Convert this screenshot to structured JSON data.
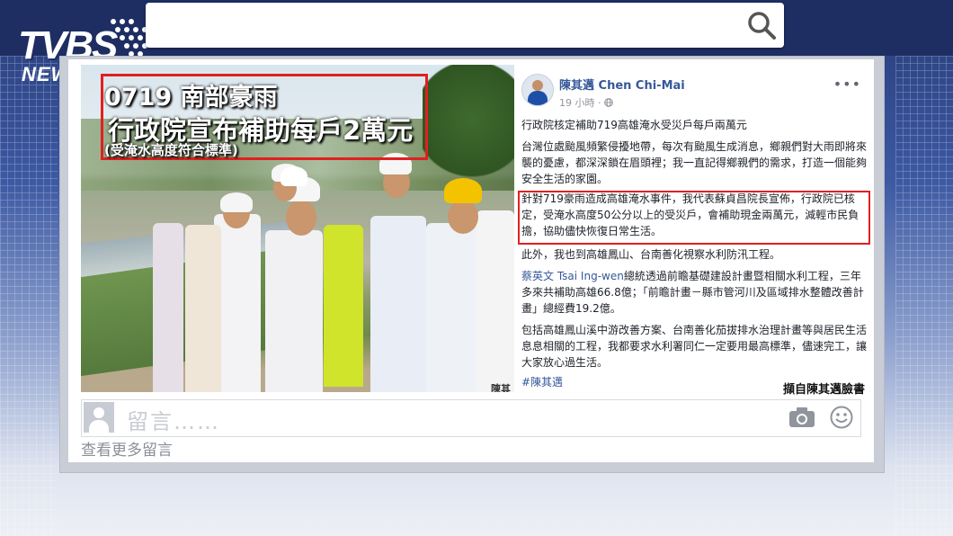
{
  "header": {
    "logo_main": "TVBS",
    "logo_sub": "NEWS"
  },
  "photo": {
    "title_line1": "0719 南部豪雨",
    "title_line2": "行政院宣布補助每戶2萬元",
    "title_line3": "(受淹水高度符合標準)",
    "watermark": "陳其"
  },
  "post": {
    "author": "陳其邁 Chen Chi-Mai",
    "time": "19 小時 · ",
    "p1": "行政院核定補助719高雄淹水受災戶每戶兩萬元",
    "p2": "台灣位處颱風頻繁侵擾地帶，每次有颱風生成消息，鄉親們對大雨即將來襲的憂慮，都深深鎖在眉頭裡；我一直記得鄉親們的需求，打造一個能夠安全生活的家園。",
    "p3": "針對719豪雨造成高雄淹水事件，我代表蘇貞昌院長宣佈，行政院已核定，受淹水高度50公分以上的受災戶，會補助現金兩萬元，減輕市民負擔，協助儘快恢復日常生活。",
    "p4": "此外，我也到高雄鳳山、台南善化視察水利防汛工程。",
    "p5_pre": "蔡英文 ",
    "p5_link": "Tsai Ing-wen",
    "p5_post": "總統透過前瞻基礎建設計畫暨相關水利工程，三年多來共補助高雄66.8億；「前瞻計畫－縣市管河川及區域排水整體改善計畫」總經費19.2億。",
    "p6": "包括高雄鳳山溪中游改善方案、台南善化茄拔排水治理計畫等與居民生活息息相關的工程，我都要求水利署同仁一定要用最高標準，儘速完工，讓大家放心過生活。",
    "hashtag": "#陳其邁",
    "source": "擷自陳其邁臉書"
  },
  "comments": {
    "placeholder": "留言……",
    "more": "查看更多留言"
  },
  "icons": [
    "search-icon",
    "more-icon",
    "camera-icon",
    "smile-icon",
    "avatar"
  ],
  "colors": {
    "highlight": "#e02020",
    "link": "#365899",
    "header_bg": "#1e2e63"
  }
}
